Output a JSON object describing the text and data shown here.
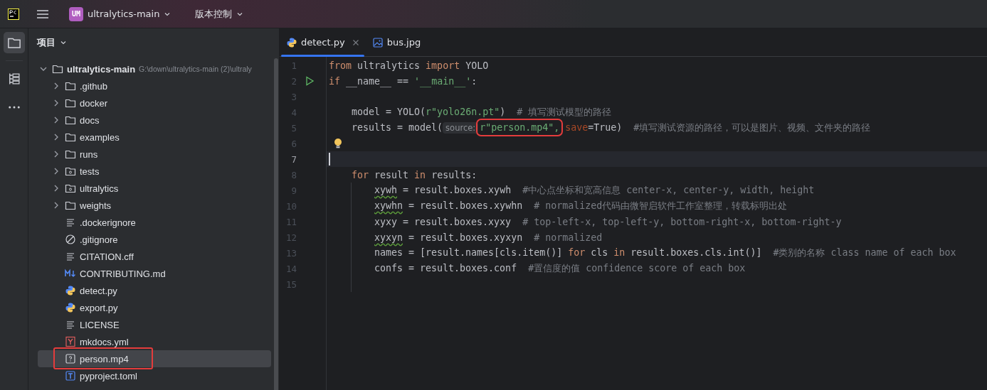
{
  "title_bar": {
    "project_badge": "UM",
    "project_name": "ultralytics-main",
    "vcs_menu": "版本控制"
  },
  "project_panel": {
    "title": "项目",
    "tree": [
      {
        "name": "ultralytics-main",
        "kind": "folder",
        "path": "G:\\down\\ultralytics-main (2)\\ultraly",
        "expanded": true,
        "selected": false,
        "annotated": false,
        "children": [
          {
            "name": ".github",
            "kind": "folder",
            "expanded": false,
            "selected": false,
            "annotated": false
          },
          {
            "name": "docker",
            "kind": "folder",
            "expanded": false,
            "selected": false,
            "annotated": false
          },
          {
            "name": "docs",
            "kind": "folder",
            "expanded": false,
            "selected": false,
            "annotated": false
          },
          {
            "name": "examples",
            "kind": "folder",
            "expanded": false,
            "selected": false,
            "annotated": false
          },
          {
            "name": "runs",
            "kind": "folder",
            "expanded": false,
            "selected": false,
            "annotated": false
          },
          {
            "name": "tests",
            "kind": "package",
            "expanded": false,
            "selected": false,
            "annotated": false
          },
          {
            "name": "ultralytics",
            "kind": "package",
            "expanded": false,
            "selected": false,
            "annotated": false
          },
          {
            "name": "weights",
            "kind": "folder",
            "expanded": false,
            "selected": false,
            "annotated": false
          },
          {
            "name": ".dockerignore",
            "kind": "text",
            "selected": false,
            "annotated": false
          },
          {
            "name": ".gitignore",
            "kind": "ignore",
            "selected": false,
            "annotated": false
          },
          {
            "name": "CITATION.cff",
            "kind": "text",
            "selected": false,
            "annotated": false
          },
          {
            "name": "CONTRIBUTING.md",
            "kind": "markdown",
            "selected": false,
            "annotated": false
          },
          {
            "name": "detect.py",
            "kind": "python",
            "selected": false,
            "annotated": false
          },
          {
            "name": "export.py",
            "kind": "python",
            "selected": false,
            "annotated": false
          },
          {
            "name": "LICENSE",
            "kind": "text",
            "selected": false,
            "annotated": false
          },
          {
            "name": "mkdocs.yml",
            "kind": "yaml",
            "selected": false,
            "annotated": false
          },
          {
            "name": "person.mp4",
            "kind": "unknown",
            "selected": true,
            "annotated": true
          },
          {
            "name": "pyproject.toml",
            "kind": "toml",
            "selected": false,
            "annotated": false
          }
        ]
      }
    ]
  },
  "tabs": [
    {
      "label": "detect.py",
      "kind": "python",
      "selected": true,
      "closable": true
    },
    {
      "label": "bus.jpg",
      "kind": "image",
      "selected": false,
      "closable": false
    }
  ],
  "editor": {
    "lines": [
      {
        "number": "1",
        "current": false,
        "run": false,
        "bulb": false,
        "guide": false,
        "tokens": [
          {
            "kind": "kw",
            "text": "from "
          },
          {
            "kind": "plain",
            "text": "ultralytics "
          },
          {
            "kind": "kw",
            "text": "import "
          },
          {
            "kind": "plain",
            "text": "YOLO"
          }
        ]
      },
      {
        "number": "2",
        "current": false,
        "run": true,
        "bulb": false,
        "guide": false,
        "tokens": [
          {
            "kind": "kw",
            "text": "if "
          },
          {
            "kind": "plain",
            "text": "__name__ == "
          },
          {
            "kind": "str",
            "text": "'__main__'"
          },
          {
            "kind": "plain",
            "text": ":"
          }
        ]
      },
      {
        "number": "3",
        "current": false,
        "run": false,
        "bulb": false,
        "guide": false
      },
      {
        "number": "4",
        "current": false,
        "run": false,
        "bulb": false,
        "guide": false,
        "tokens": [
          {
            "kind": "plain",
            "text": "    model = YOLO("
          },
          {
            "kind": "str",
            "text": "r\"yolo26n.pt\""
          },
          {
            "kind": "plain",
            "text": ")  "
          },
          {
            "kind": "cmt",
            "text": "# 填写测试模型的路径"
          }
        ]
      },
      {
        "number": "5",
        "current": false,
        "run": false,
        "bulb": false,
        "guide": false,
        "tokens": [
          {
            "kind": "plain",
            "text": "    results = model("
          },
          {
            "kind": "hint",
            "text": "source:"
          },
          {
            "kind": "str",
            "text": "r\"person.mp4\",",
            "annotated": true
          },
          {
            "kind": "param",
            "text": " save"
          },
          {
            "kind": "plain",
            "text": "=True)  "
          },
          {
            "kind": "cmt",
            "text": "#填写测试资源的路径，可以是图片、视频、文件夹的路径"
          }
        ]
      },
      {
        "number": "6",
        "current": false,
        "run": false,
        "bulb": true,
        "guide": false
      },
      {
        "number": "7",
        "current": true,
        "run": false,
        "bulb": false,
        "guide": false
      },
      {
        "number": "8",
        "current": false,
        "run": false,
        "bulb": false,
        "guide": false,
        "tokens": [
          {
            "kind": "kw",
            "text": "    for "
          },
          {
            "kind": "plain",
            "text": "result "
          },
          {
            "kind": "kw",
            "text": "in "
          },
          {
            "kind": "plain",
            "text": "results:"
          }
        ]
      },
      {
        "number": "9",
        "current": false,
        "run": false,
        "bulb": false,
        "guide": true,
        "tokens": [
          {
            "kind": "warn",
            "text": "xywh"
          },
          {
            "kind": "plain",
            "text": " = result.boxes.xywh  "
          },
          {
            "kind": "cmt",
            "text": "#中心点坐标和宽高信息 center-x, center-y, width, height"
          }
        ]
      },
      {
        "number": "10",
        "current": false,
        "run": false,
        "bulb": false,
        "guide": true,
        "tokens": [
          {
            "kind": "warn",
            "text": "xywhn"
          },
          {
            "kind": "plain",
            "text": " = result.boxes.xywhn  "
          },
          {
            "kind": "cmt",
            "text": "# normalized代码由微智启软件工作室整理，转载标明出处"
          }
        ]
      },
      {
        "number": "11",
        "current": false,
        "run": false,
        "bulb": false,
        "guide": true,
        "tokens": [
          {
            "kind": "plain",
            "text": "xyxy = result.boxes.xyxy  "
          },
          {
            "kind": "cmt",
            "text": "# top-left-x, top-left-y, bottom-right-x, bottom-right-y"
          }
        ]
      },
      {
        "number": "12",
        "current": false,
        "run": false,
        "bulb": false,
        "guide": true,
        "tokens": [
          {
            "kind": "warn",
            "text": "xyxyn"
          },
          {
            "kind": "plain",
            "text": " = result.boxes.xyxyn  "
          },
          {
            "kind": "cmt",
            "text": "# normalized"
          }
        ]
      },
      {
        "number": "13",
        "current": false,
        "run": false,
        "bulb": false,
        "guide": true,
        "tokens": [
          {
            "kind": "plain",
            "text": "names = [result.names[cls.item()] "
          },
          {
            "kind": "kw",
            "text": "for "
          },
          {
            "kind": "plain",
            "text": "cls "
          },
          {
            "kind": "kw",
            "text": "in "
          },
          {
            "kind": "plain",
            "text": "result.boxes.cls.int()]  "
          },
          {
            "kind": "cmt",
            "text": "#类别的名称 class name of each box"
          }
        ]
      },
      {
        "number": "14",
        "current": false,
        "run": false,
        "bulb": false,
        "guide": true,
        "tokens": [
          {
            "kind": "plain",
            "text": "confs = result.boxes.conf  "
          },
          {
            "kind": "cmt",
            "text": "#置信度的值 confidence score of each box"
          }
        ]
      },
      {
        "number": "15",
        "current": false,
        "run": false,
        "bulb": false,
        "guide": true
      }
    ]
  }
}
